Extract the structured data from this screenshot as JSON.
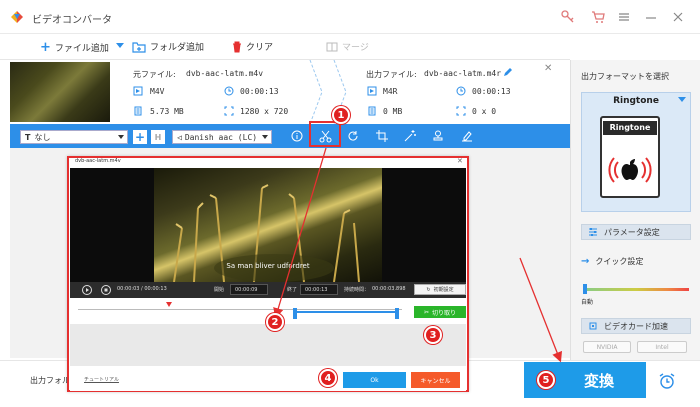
{
  "app": {
    "title": "ビデオコンバータ",
    "colors": {
      "accent": "#2d8fe8",
      "annotation": "#e53030",
      "cut": "#2ab52a",
      "cancel": "#f55a2a"
    }
  },
  "toolbar": {
    "add_file": "ファイル追加",
    "add_folder": "フォルダ追加",
    "clear": "クリア",
    "merge": "マージ"
  },
  "source": {
    "label": "元ファイル:",
    "name": "dvb-aac-latm.m4v",
    "format": "M4V",
    "duration": "00:00:13",
    "size": "5.73 MB",
    "resolution": "1280 x 720"
  },
  "output": {
    "label": "出力ファイル:",
    "name": "dvb-aac-latm.m4r",
    "format": "M4R",
    "duration": "00:00:13",
    "size": "0 MB",
    "resolution": "0 x 0"
  },
  "editbar": {
    "subtitle": "なし",
    "audio": "Danish aac (LC)"
  },
  "right_panel": {
    "title": "出力フォーマットを選択",
    "format_name": "Ringtone",
    "icon_label": "Ringtone",
    "param_settings": "パラメータ設定",
    "quick_settings": "クイック設定",
    "auto": "自動",
    "gpu_accel": "ビデオカード加速",
    "gpu_nvidia": "NVIDIA",
    "gpu_intel": "Intel"
  },
  "bottom": {
    "output_folder_label": "出力フォル",
    "convert": "変換"
  },
  "dialog": {
    "title": "dvb-aac-latm.m4v",
    "subtitle_text": "Sa man bliver udfordret",
    "time_current": "00:00:03 / 00:00:13",
    "start_label": "開始",
    "start_value": "00:00:09",
    "end_label": "終了",
    "end_value": "00:00:13",
    "duration_label": "持続時間：",
    "duration_value": "00:00:03.898",
    "reset": "初期設定",
    "cut": "切り取り",
    "tutorial": "チュートリアル",
    "ok": "Ok",
    "cancel": "キャンセル"
  },
  "annotations": [
    "1",
    "2",
    "3",
    "4",
    "5"
  ]
}
